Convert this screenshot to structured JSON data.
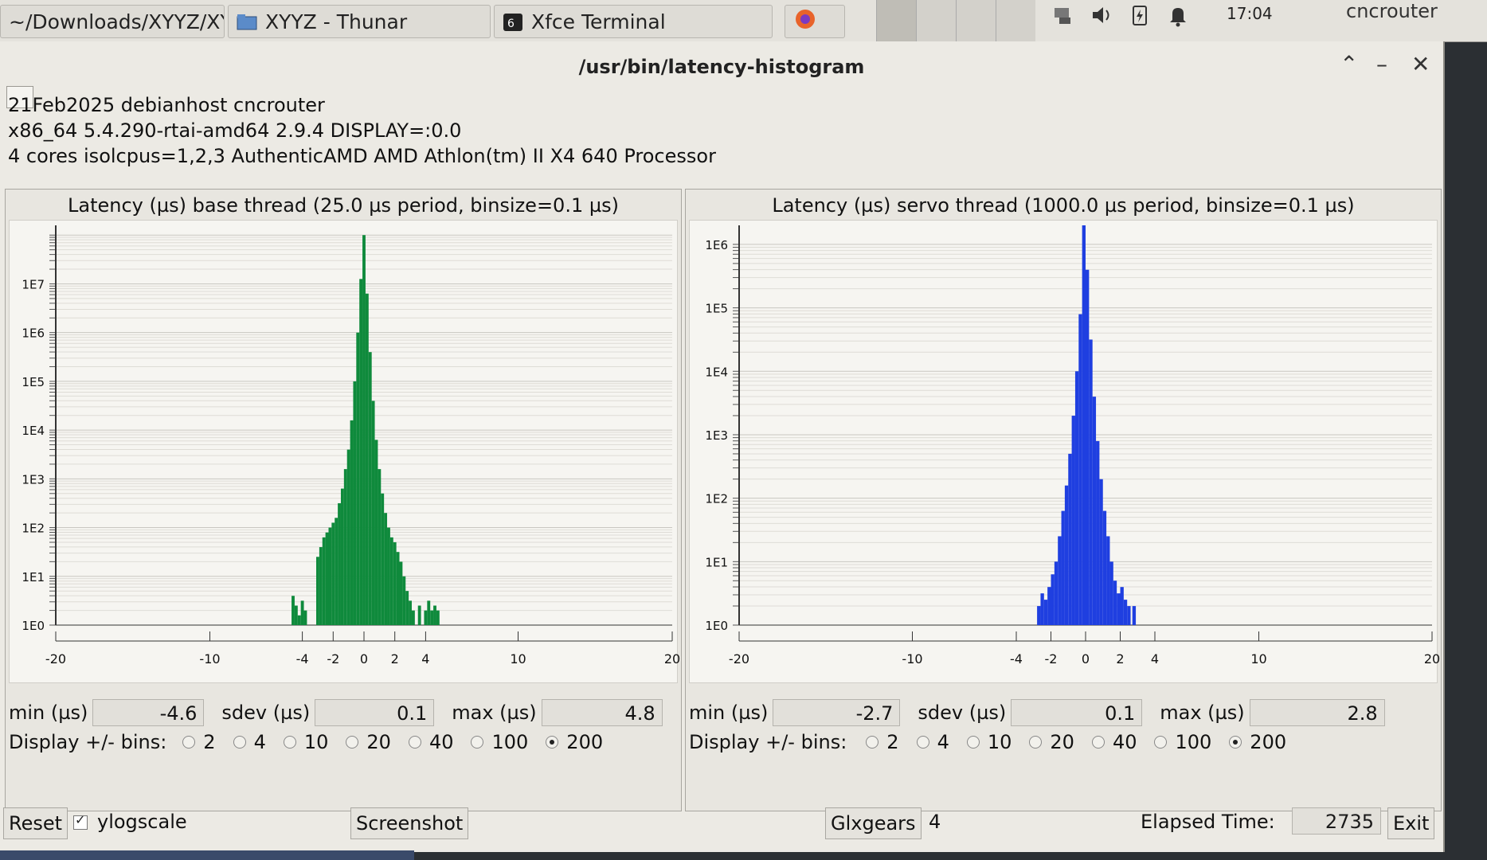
{
  "taskbar": {
    "tasks": [
      {
        "label": "~/Downloads/XYYZ/XY..."
      },
      {
        "label": "XYYZ - Thunar"
      },
      {
        "label": "Xfce Terminal"
      }
    ],
    "clock_time": "17:04",
    "user": "cncrouter"
  },
  "window": {
    "title": "/usr/bin/latency-histogram"
  },
  "sysinfo": {
    "line1": "21Feb2025 debianhost cncrouter",
    "line2": "x86_64  5.4.290-rtai-amd64  2.9.4  DISPLAY=:0.0",
    "line3": "4 cores  isolcpus=1,2,3   AuthenticAMD  AMD Athlon(tm) II X4 640 Processor"
  },
  "base": {
    "title": "Latency (µs) base thread (25.0 µs period, binsize=0.1 µs)",
    "min_label": "min (µs)",
    "min": "-4.6",
    "sdev_label": "sdev (µs)",
    "sdev": "0.1",
    "max_label": "max (µs)",
    "max": "4.8",
    "bins_label": "Display +/- bins:"
  },
  "servo": {
    "title": "Latency (µs) servo thread (1000.0 µs period, binsize=0.1 µs)",
    "min_label": "min (µs)",
    "min": "-2.7",
    "sdev_label": "sdev (µs)",
    "sdev": "0.1",
    "max_label": "max (µs)",
    "max": "2.8",
    "bins_label": "Display +/- bins:"
  },
  "bin_options": [
    "2",
    "4",
    "10",
    "20",
    "40",
    "100",
    "200"
  ],
  "bin_selected": "200",
  "bottom": {
    "reset": "Reset",
    "ylogscale": "ylogscale",
    "ylogscale_checked": true,
    "screenshot": "Screenshot",
    "glxgears": "Glxgears",
    "glxgears_count": "4",
    "elapsed_label": "Elapsed Time:",
    "elapsed": "2735",
    "exit": "Exit"
  },
  "colors": {
    "base": "#0f8a3c",
    "servo": "#1f3fe0"
  },
  "chart_data": [
    {
      "type": "bar",
      "title": "Latency (µs) base thread (25.0 µs period, binsize=0.1 µs)",
      "xlim": [
        -20,
        20
      ],
      "xticks": [
        "-20",
        "-10",
        "-4",
        "-2",
        "0",
        "2",
        "4",
        "10",
        "20"
      ],
      "yscale": "log",
      "yticks": [
        "1E0",
        "1E1",
        "1E2",
        "1E3",
        "1E4",
        "1E5",
        "1E6",
        "1E7"
      ],
      "ylim_exp": [
        0,
        8.2
      ],
      "color": "#0f8a3c",
      "x": [
        -4.6,
        -4.4,
        -4.2,
        -4.0,
        -3.8,
        -3.0,
        -2.8,
        -2.6,
        -2.4,
        -2.2,
        -2.0,
        -1.8,
        -1.6,
        -1.4,
        -1.2,
        -1.0,
        -0.8,
        -0.6,
        -0.4,
        -0.2,
        0.0,
        0.2,
        0.4,
        0.6,
        0.8,
        1.0,
        1.2,
        1.4,
        1.6,
        1.8,
        2.0,
        2.2,
        2.4,
        2.6,
        2.8,
        3.0,
        3.2,
        3.6,
        4.0,
        4.2,
        4.4,
        4.6,
        4.8
      ],
      "log10_counts": [
        0.6,
        0.4,
        0.2,
        0.5,
        0.3,
        1.4,
        1.6,
        1.8,
        1.9,
        2.0,
        2.1,
        2.2,
        2.5,
        2.8,
        3.2,
        3.6,
        4.2,
        5.0,
        6.0,
        7.1,
        8.0,
        6.8,
        5.6,
        4.6,
        3.8,
        3.2,
        2.7,
        2.3,
        2.0,
        1.8,
        1.7,
        1.5,
        1.3,
        1.0,
        0.7,
        0.5,
        0.3,
        0.4,
        0.3,
        0.5,
        0.3,
        0.4,
        0.3
      ]
    },
    {
      "type": "bar",
      "title": "Latency (µs) servo thread (1000.0 µs period, binsize=0.1 µs)",
      "xlim": [
        -20,
        20
      ],
      "xticks": [
        "-20",
        "-10",
        "-4",
        "-2",
        "0",
        "2",
        "4",
        "10",
        "20"
      ],
      "yscale": "log",
      "yticks": [
        "1E0",
        "1E1",
        "1E2",
        "1E3",
        "1E4",
        "1E5",
        "1E6"
      ],
      "ylim_exp": [
        0,
        6.3
      ],
      "color": "#1f3fe0",
      "x": [
        -2.7,
        -2.5,
        -2.3,
        -2.1,
        -1.9,
        -1.7,
        -1.5,
        -1.3,
        -1.1,
        -0.9,
        -0.7,
        -0.5,
        -0.3,
        -0.1,
        0.1,
        0.3,
        0.5,
        0.7,
        0.9,
        1.1,
        1.3,
        1.5,
        1.7,
        1.9,
        2.1,
        2.3,
        2.5,
        2.8
      ],
      "log10_counts": [
        0.3,
        0.5,
        0.4,
        0.6,
        0.8,
        1.0,
        1.4,
        1.8,
        2.2,
        2.7,
        3.3,
        4.0,
        4.9,
        6.3,
        5.6,
        4.5,
        3.6,
        2.9,
        2.3,
        1.8,
        1.4,
        1.0,
        0.7,
        0.5,
        0.6,
        0.4,
        0.3,
        0.3
      ]
    }
  ]
}
